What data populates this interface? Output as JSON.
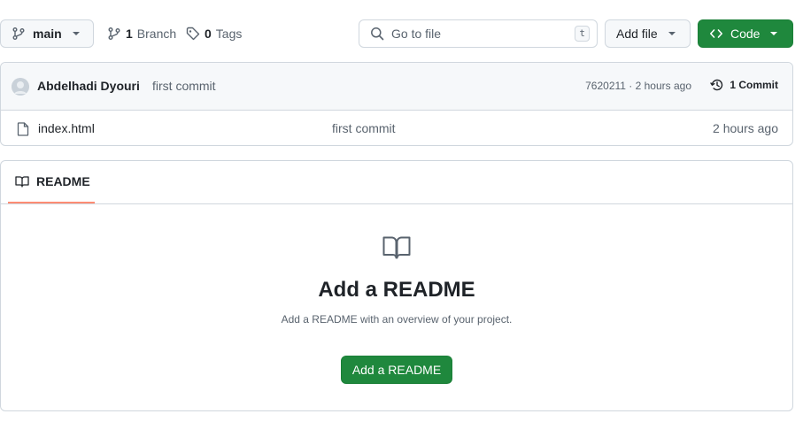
{
  "colors": {
    "primary": "#1f883d",
    "border": "#d0d7de",
    "muted": "#59636e",
    "tab_underline": "#fd8c73"
  },
  "toolbar": {
    "branch": "main",
    "branches_count": "1",
    "branches_label": "Branch",
    "tags_count": "0",
    "tags_label": "Tags",
    "goto_placeholder": "Go to file",
    "goto_shortcut": "t",
    "add_file_label": "Add file",
    "code_label": "Code"
  },
  "commit": {
    "author": "Abdelhadi Dyouri",
    "message": "first commit",
    "meta": "7620211 · 2 hours ago",
    "commits_label": "1 Commit"
  },
  "files": [
    {
      "name": "index.html",
      "commit": "first commit",
      "age": "2 hours ago",
      "icon": "file-icon"
    }
  ],
  "readme": {
    "tab_label": "README",
    "title": "Add a README",
    "description": "Add a README with an overview of your project.",
    "button_label": "Add a README",
    "icon": "book-icon"
  }
}
